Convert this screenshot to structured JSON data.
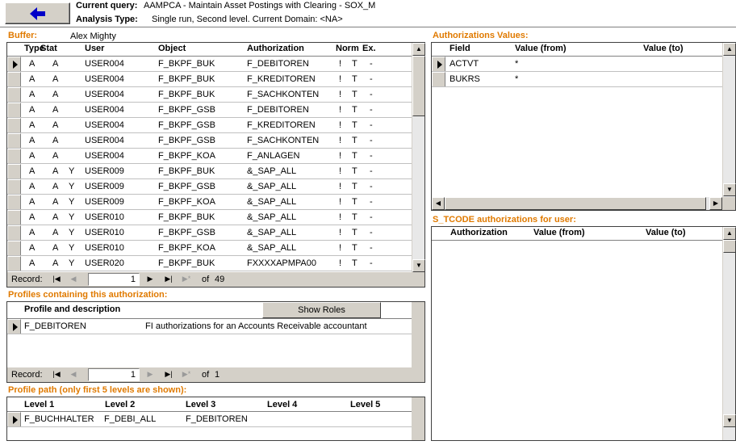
{
  "header": {
    "current_query_label": "Current query:",
    "current_query_value": "AAMPCA - Maintain Asset Postings with Clearing - SOX_M",
    "analysis_type_label": "Analysis Type:",
    "analysis_type_value": "Single run, Second level. Current Domain: <NA>"
  },
  "buffer": {
    "title": "Buffer:",
    "user_name": "Alex Mighty",
    "columns": [
      "Type",
      "Stat",
      "User",
      "Object",
      "Authorization",
      "Norm",
      "Ex."
    ],
    "rows": [
      {
        "type": "A",
        "stat": "A",
        "flag": "",
        "user": "USER004",
        "object": "F_BKPF_BUK",
        "auth": "F_DEBITOREN",
        "norm": "!",
        "t": "T",
        "ex": "-"
      },
      {
        "type": "A",
        "stat": "A",
        "flag": "",
        "user": "USER004",
        "object": "F_BKPF_BUK",
        "auth": "F_KREDITOREN",
        "norm": "!",
        "t": "T",
        "ex": "-"
      },
      {
        "type": "A",
        "stat": "A",
        "flag": "",
        "user": "USER004",
        "object": "F_BKPF_BUK",
        "auth": "F_SACHKONTEN",
        "norm": "!",
        "t": "T",
        "ex": "-"
      },
      {
        "type": "A",
        "stat": "A",
        "flag": "",
        "user": "USER004",
        "object": "F_BKPF_GSB",
        "auth": "F_DEBITOREN",
        "norm": "!",
        "t": "T",
        "ex": "-"
      },
      {
        "type": "A",
        "stat": "A",
        "flag": "",
        "user": "USER004",
        "object": "F_BKPF_GSB",
        "auth": "F_KREDITOREN",
        "norm": "!",
        "t": "T",
        "ex": "-"
      },
      {
        "type": "A",
        "stat": "A",
        "flag": "",
        "user": "USER004",
        "object": "F_BKPF_GSB",
        "auth": "F_SACHKONTEN",
        "norm": "!",
        "t": "T",
        "ex": "-"
      },
      {
        "type": "A",
        "stat": "A",
        "flag": "",
        "user": "USER004",
        "object": "F_BKPF_KOA",
        "auth": "F_ANLAGEN",
        "norm": "!",
        "t": "T",
        "ex": "-"
      },
      {
        "type": "A",
        "stat": "A",
        "flag": "Y",
        "user": "USER009",
        "object": "F_BKPF_BUK",
        "auth": "&_SAP_ALL",
        "norm": "!",
        "t": "T",
        "ex": "-"
      },
      {
        "type": "A",
        "stat": "A",
        "flag": "Y",
        "user": "USER009",
        "object": "F_BKPF_GSB",
        "auth": "&_SAP_ALL",
        "norm": "!",
        "t": "T",
        "ex": "-"
      },
      {
        "type": "A",
        "stat": "A",
        "flag": "Y",
        "user": "USER009",
        "object": "F_BKPF_KOA",
        "auth": "&_SAP_ALL",
        "norm": "!",
        "t": "T",
        "ex": "-"
      },
      {
        "type": "A",
        "stat": "A",
        "flag": "Y",
        "user": "USER010",
        "object": "F_BKPF_BUK",
        "auth": "&_SAP_ALL",
        "norm": "!",
        "t": "T",
        "ex": "-"
      },
      {
        "type": "A",
        "stat": "A",
        "flag": "Y",
        "user": "USER010",
        "object": "F_BKPF_GSB",
        "auth": "&_SAP_ALL",
        "norm": "!",
        "t": "T",
        "ex": "-"
      },
      {
        "type": "A",
        "stat": "A",
        "flag": "Y",
        "user": "USER010",
        "object": "F_BKPF_KOA",
        "auth": "&_SAP_ALL",
        "norm": "!",
        "t": "T",
        "ex": "-"
      },
      {
        "type": "A",
        "stat": "A",
        "flag": "Y",
        "user": "USER020",
        "object": "F_BKPF_BUK",
        "auth": "FXXXXAPMPA00",
        "norm": "!",
        "t": "T",
        "ex": "-"
      }
    ],
    "nav": {
      "record_label": "Record:",
      "current": "1",
      "of_label": "of",
      "total": "49"
    }
  },
  "profiles": {
    "title": "Profiles containing this authorization:",
    "column": "Profile and description",
    "show_roles_label": "Show Roles",
    "rows": [
      {
        "profile": "F_DEBITOREN",
        "description": "FI authorizations for an Accounts Receivable accountant"
      }
    ],
    "nav": {
      "record_label": "Record:",
      "current": "1",
      "of_label": "of",
      "total": "1"
    }
  },
  "profile_path": {
    "title": "Profile path (only first 5 levels are shown):",
    "columns": [
      "Level 1",
      "Level 2",
      "Level 3",
      "Level 4",
      "Level 5"
    ],
    "rows": [
      {
        "l1": "F_BUCHHALTER",
        "l2": "F_DEBI_ALL",
        "l3": "F_DEBITOREN",
        "l4": "",
        "l5": ""
      }
    ]
  },
  "auth_values": {
    "title": "Authorizations Values:",
    "columns": [
      "Field",
      "Value (from)",
      "Value (to)"
    ],
    "rows": [
      {
        "field": "ACTVT",
        "from": "*",
        "to": ""
      },
      {
        "field": "BUKRS",
        "from": "*",
        "to": ""
      }
    ]
  },
  "s_tcode": {
    "title": "S_TCODE authorizations for user:",
    "columns": [
      "Authorization",
      "Value (from)",
      "Value (to)"
    ]
  },
  "icons": {
    "back": "back-arrow-icon",
    "first": "first-record-icon",
    "prev": "previous-record-icon",
    "next": "next-record-icon",
    "last": "last-record-icon",
    "new": "new-record-icon",
    "record_selector": "record-selector-icon",
    "scroll_up": "scroll-up-icon",
    "scroll_down": "scroll-down-icon",
    "scroll_left": "scroll-left-icon",
    "scroll_right": "scroll-right-icon"
  },
  "colors": {
    "section_title": "#e07a00",
    "back_arrow": "#0000c8",
    "face": "#d4d0c8"
  }
}
